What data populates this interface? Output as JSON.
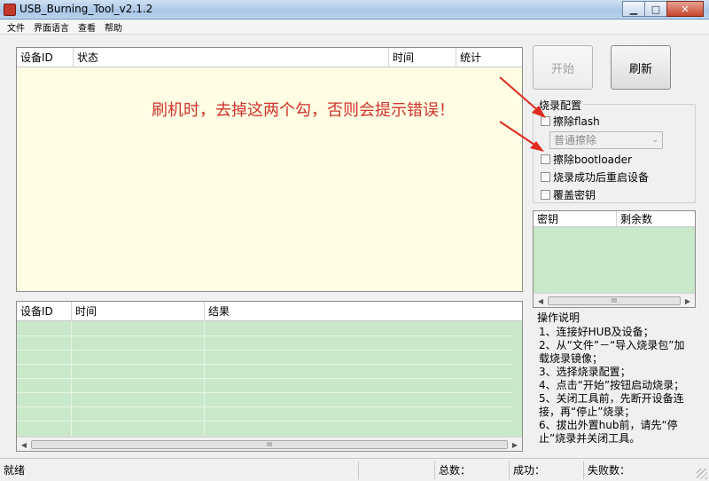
{
  "window": {
    "title": "USB_Burning_Tool_v2.1.2",
    "minimize": "▁",
    "maximize": "□",
    "close": "✕"
  },
  "menu": [
    "文件",
    "界面语言",
    "查看",
    "帮助"
  ],
  "device_table": {
    "columns": [
      "设备ID",
      "状态",
      "时间",
      "统计"
    ]
  },
  "annotation": "刷机时，去掉这两个勾，否则会提示错误！",
  "buttons": {
    "start": "开始",
    "refresh": "刷新"
  },
  "burn_config": {
    "title": "烧录配置",
    "erase_flash": "擦除flash",
    "erase_mode": "普通擦除",
    "erase_bootloader": "擦除bootloader",
    "reboot_after": "烧录成功后重启设备",
    "overwrite_key": "覆盖密钥"
  },
  "key_table": {
    "columns": [
      "密钥",
      "剩余数"
    ]
  },
  "result_table": {
    "columns": [
      "设备ID",
      "时间",
      "结果"
    ]
  },
  "instructions": {
    "title": "操作说明",
    "body": "1、连接好HUB及设备；\n2、从“文件”－“导入烧录包”加载烧录镜像；\n3、选择烧录配置；\n4、点击“开始”按钮启动烧录；\n5、关闭工具前，先断开设备连接，再“停止”烧录；\n6、拔出外置hub前，请先“停止”烧录并关闭工具。"
  },
  "status": {
    "ready": "就绪",
    "total": "总数：",
    "success": "成功：",
    "failed": "失败数："
  },
  "scroll": {
    "left": "◀",
    "right": "▶",
    "thumb": "III"
  },
  "colors": {
    "annotation_red": "#d0342c",
    "result_green": "#c9e7c9",
    "device_yellow": "#fffde3"
  }
}
